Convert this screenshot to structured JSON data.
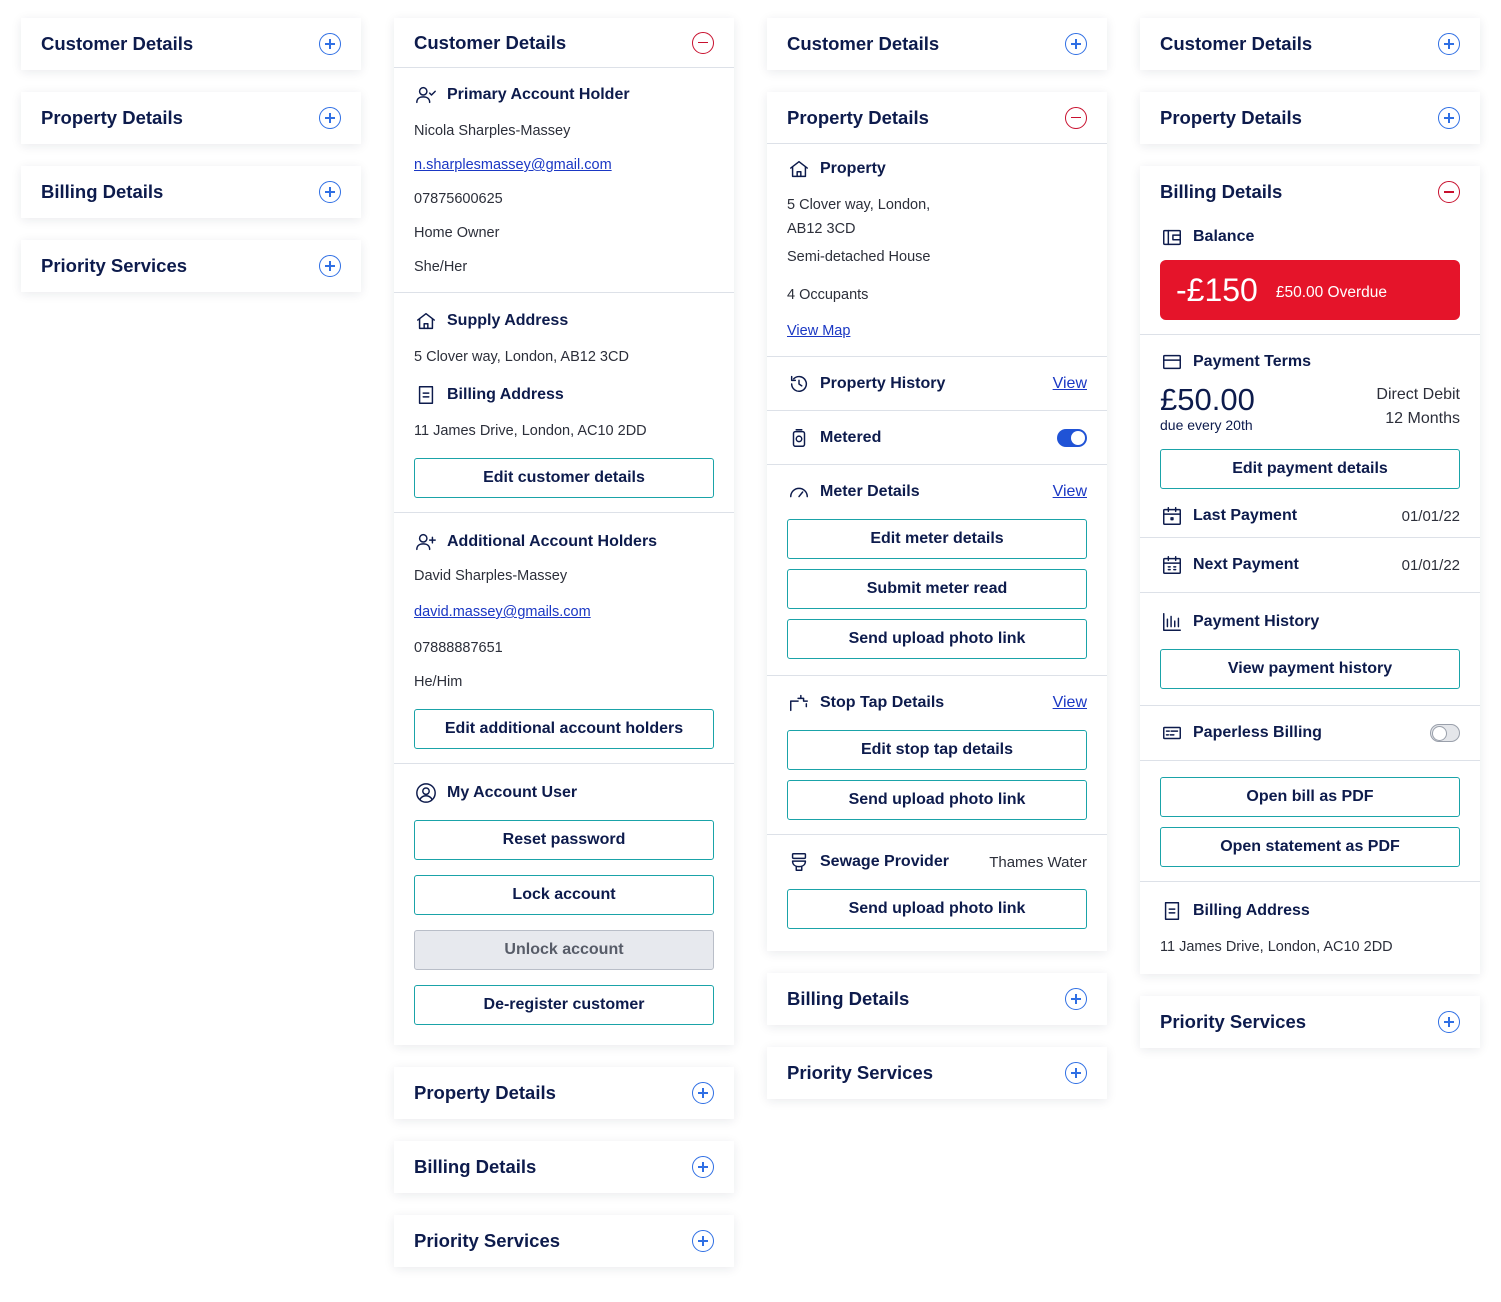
{
  "colors": {
    "navy": "#0d1b4c",
    "plus_blue": "#2f6fe4",
    "minus_red": "#c8102e",
    "balance_red": "#e5142a",
    "teal_border": "#1aa3a8",
    "link_blue": "#1a37c4"
  },
  "accordion_titles": {
    "customer": "Customer Details",
    "property": "Property Details",
    "billing": "Billing Details",
    "priority": "Priority Services"
  },
  "customer": {
    "primary": {
      "title": "Primary Account Holder",
      "name": "Nicola Sharples-Massey",
      "email": "n.sharplesmassey@gmail.com",
      "phone": "07875600625",
      "role": "Home Owner",
      "pronouns": "She/Her"
    },
    "supply": {
      "title": "Supply Address",
      "address": "5 Clover way, London, AB12 3CD"
    },
    "billing_addr": {
      "title": "Billing Address",
      "address": "11 James Drive, London, AC10 2DD"
    },
    "edit_customer": "Edit customer details",
    "additional": {
      "title": "Additional Account Holders",
      "name": "David Sharples-Massey",
      "email": "david.massey@gmails.com",
      "phone": "07888887651",
      "pronouns": "He/Him",
      "edit": "Edit additional account holders"
    },
    "account_user": {
      "title": "My Account User",
      "reset": "Reset password",
      "lock": "Lock account",
      "unlock": "Unlock account",
      "deregister": "De-register customer"
    }
  },
  "property": {
    "title": "Property",
    "address_1": "5 Clover way, London,",
    "address_2": "AB12 3CD",
    "type": "Semi-detached House",
    "occupants": "4 Occupants",
    "view_map": "View Map",
    "history": {
      "title": "Property History",
      "view": "View"
    },
    "metered": {
      "title": "Metered",
      "on": true
    },
    "meter": {
      "title": "Meter Details",
      "view": "View",
      "edit": "Edit meter details",
      "submit": "Submit meter read",
      "upload": "Send upload photo link"
    },
    "stoptap": {
      "title": "Stop Tap Details",
      "view": "View",
      "edit": "Edit stop tap details",
      "upload": "Send upload photo link"
    },
    "sewage": {
      "title": "Sewage Provider",
      "value": "Thames Water",
      "upload": "Send upload photo link"
    }
  },
  "billing": {
    "balance": {
      "title": "Balance",
      "amount": "-£150",
      "overdue": "£50.00 Overdue"
    },
    "terms": {
      "title": "Payment Terms",
      "amount": "£50.00",
      "due": "due every 20th",
      "method": "Direct Debit",
      "period": "12 Months",
      "edit": "Edit payment details"
    },
    "last_payment": {
      "title": "Last Payment",
      "date": "01/01/22"
    },
    "next_payment": {
      "title": "Next Payment",
      "date": "01/01/22"
    },
    "history": {
      "title": "Payment History",
      "button": "View payment history"
    },
    "paperless": {
      "title": "Paperless Billing",
      "on": false
    },
    "open_bill": "Open bill as PDF",
    "open_statement": "Open statement as PDF",
    "address": {
      "title": "Billing Address",
      "value": "11 James Drive, London, AC10 2DD"
    }
  },
  "icons": [
    "plus-circle-icon",
    "minus-circle-icon",
    "user-check-icon",
    "home-icon",
    "document-icon",
    "user-plus-icon",
    "user-circle-icon",
    "history-icon",
    "meter-icon",
    "gauge-icon",
    "tap-icon",
    "toilet-icon",
    "wallet-icon",
    "credit-card-icon",
    "calendar-icon",
    "bar-chart-icon",
    "paperless-icon"
  ]
}
